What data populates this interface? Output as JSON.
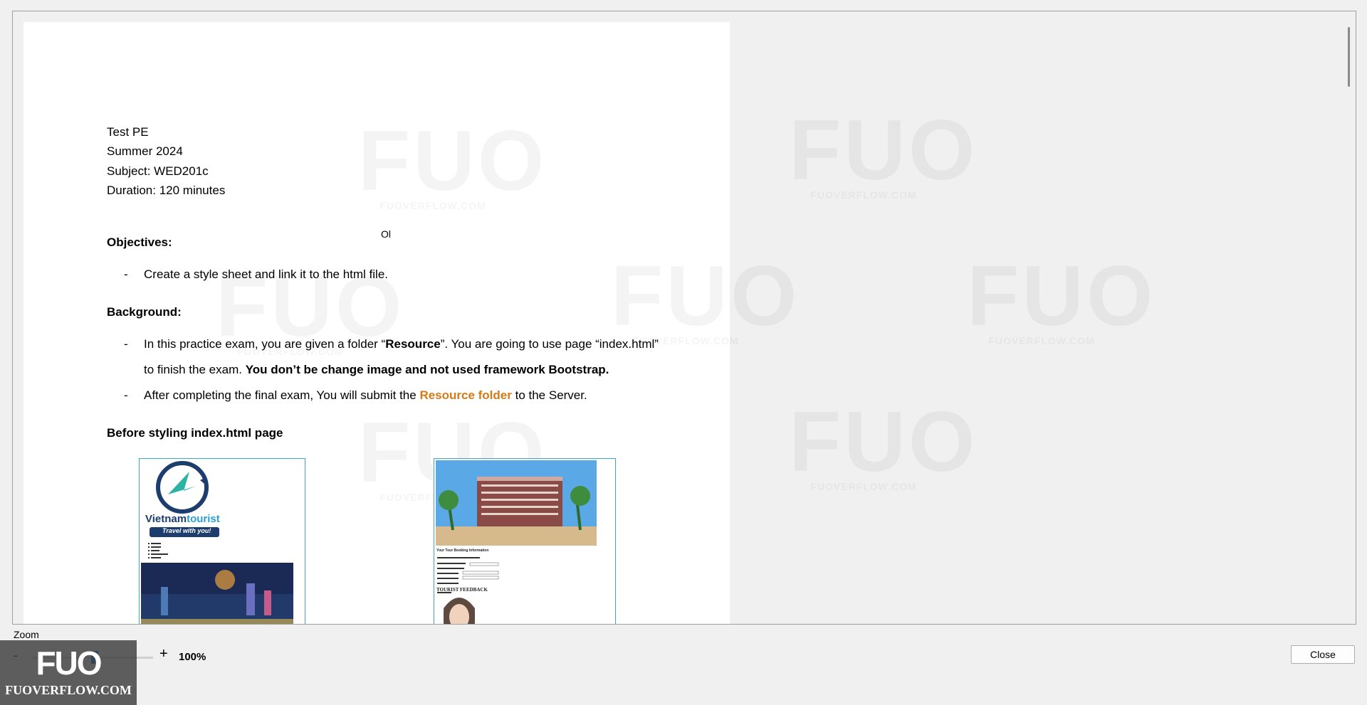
{
  "document": {
    "header_lines": [
      "Test PE",
      "Summer 2024",
      "Subject: WED201c",
      "Duration: 120 minutes"
    ],
    "stray_text": "Ol",
    "objectives_heading": "Objectives:",
    "objectives_items": [
      "Create a style sheet and link it to the html file."
    ],
    "background_heading": "Background:",
    "bullet_dash": "-",
    "background_item1_part1": "In this practice exam, you are given a folder “",
    "background_item1_bold": "Resource",
    "background_item1_part2": "”. You are going to use page “index.html”",
    "background_item1_line2_part1": "to finish the exam. ",
    "background_item1_line2_bold": "You don’t be change image and not used framework Bootstrap.",
    "background_item2_part1": "After completing the final exam, You will submit the ",
    "background_item2_highlight": "Resource folder",
    "background_item2_part2": " to the Server.",
    "before_heading": "Before styling index.html page",
    "thumb_left": {
      "brand_part1": "Vietnam",
      "brand_part2": "tourist",
      "tagline": "Travel with you!"
    },
    "thumb_right": {
      "form_title": "Your Tour Booking Information",
      "feedback_title": "TOURIST FEEDBACK"
    }
  },
  "watermark": {
    "logo": "FUO",
    "url": "FUOVERFLOW.COM"
  },
  "zoom": {
    "label": "Zoom",
    "minus": "-",
    "plus": "+",
    "value": "100%"
  },
  "close_button": "Close",
  "badge": {
    "logo": "FUO",
    "url": "FUOVERFLOW.COM"
  },
  "colors": {
    "highlight_orange": "#d47a17",
    "thumb_border": "#3ba9c8",
    "slider_accent": "#0078d7"
  }
}
